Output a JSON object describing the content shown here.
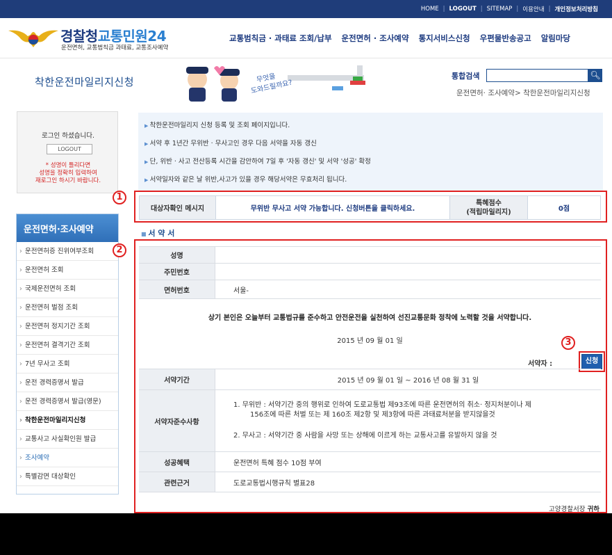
{
  "topbar": {
    "home": "HOME",
    "logout": "LOGOUT",
    "sitemap": "SITEMAP",
    "guide": "이용안내",
    "privacy": "개인정보처리방침"
  },
  "logo": {
    "title_main": "경찰청",
    "title_accent": "교통민원24",
    "subtitle": "운전면허, 교통범칙금 과태료, 교통조사예약"
  },
  "gnb": [
    "교통범칙금 · 과태료 조회/납부",
    "운전면허 · 조사예약",
    "통지서비스신청",
    "우편물반송공고",
    "알림마당"
  ],
  "page": {
    "title": "착한운전마일리지신청",
    "banner_text": "무엇을 도와드릴까요?",
    "search_label": "통합검색",
    "search_value": "",
    "breadcrumb": "운전면허· 조사예약> 착한운전마일리지신청"
  },
  "login": {
    "message": "로그인 하셨습니다.",
    "logout_button": "LOGOUT",
    "note": [
      "* 성명이 틀리다면",
      "성명을 정확히 입력하여",
      "재로그인 하시기 바랍니다."
    ]
  },
  "side_menu": {
    "title": "운전면허·조사예약",
    "items": [
      "운전면허증 진위여부조회",
      "운전면허 조회",
      "국제운전면허 조회",
      "운전면허 벌점 조회",
      "운전면허 정지기간 조회",
      "운전면허 결격기간 조회",
      "7년 무사고 조회",
      "운전 경력증명서 발급",
      "운전 경력증명서 발급(영문)",
      "착한운전마일리지신청",
      "교통사고 사실확인원 발급",
      "조사예약",
      "특별감면 대상확인"
    ]
  },
  "notice": [
    "착한운전마일리지 신청 등록 및 조회 페이지입니다.",
    "서약 후 1년간 무위반 · 무사고인 경우 다음 서약을 자동 갱신",
    "단, 위반 · 사고 전산등록 시간을 감안하여 7일 후 '자동 갱신' 및 서약 '성공' 확정",
    "서약일자와 같은 날 위반,사고가 있을 경우 해당서약은 무효처리 됩니다."
  ],
  "annotations": [
    "1",
    "2",
    "3"
  ],
  "info": {
    "label": "대상자확인 메시지",
    "message": "무위반 무사고 서약 가능합니다.  신청버튼을 클릭하세요.",
    "points_label_1": "특혜점수",
    "points_label_2": "(적립마일리지)",
    "points_value": "0점"
  },
  "pledge": {
    "section_title": "서 약 서",
    "name_label": "성명",
    "name_value": "",
    "rrn_label": "주민번호",
    "rrn_value": "",
    "license_label": "면허번호",
    "license_value": "서울-",
    "statement": "상기 본인은 오늘부터 교통법규를 준수하고 안전운전을 실천하여 선진교통문화 정착에 노력할 것을 서약합니다.",
    "date": "2015 년 09 월 01 일",
    "signer_label": "서약자 :",
    "apply_button": "신청",
    "period_label": "서약기간",
    "period_value": "2015 년 09 월 01 일 ~ 2016 년 08 월 31 일",
    "rules_label": "서약자준수사항",
    "rule1a": "1. 무위반 : 서약기간 중의 행위로 인하여 도로교통법 제93조에 따른 운전면허의 취소· 정지처분이나 제",
    "rule1b": "156조에 따른 처벌 또는 제 160조 제2항 및 제3항에 따른 과태료처분을 받지않을것",
    "rule2": "2. 무사고 : 서약기간 중 사람을 사망 또는 상해에 이르게 하는 교통사고를 유발하지 않을 것",
    "benefit_label": "성공혜택",
    "benefit_value": "운전면허 특혜 점수 10점 부여",
    "basis_label": "관련근거",
    "basis_value": "도로교통법시행규칙 별표28",
    "footer_org": "고양경찰서장",
    "footer_suffix": "귀하"
  }
}
